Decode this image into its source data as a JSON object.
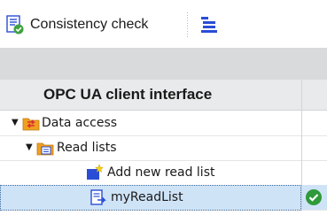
{
  "toolbar": {
    "consistency_label": "Consistency check",
    "consistency_icon": "consistency-check-icon",
    "list_icon": "list-view-icon"
  },
  "panel": {
    "title": "OPC UA client interface"
  },
  "tree": {
    "items": [
      {
        "label": "Data access",
        "icon": "data-access-folder-icon",
        "expanded": true
      },
      {
        "label": "Read lists",
        "icon": "read-lists-folder-icon",
        "expanded": true
      },
      {
        "label": "Add new read list",
        "icon": "add-new-icon"
      },
      {
        "label": "myReadList",
        "icon": "read-list-icon",
        "selected": true,
        "status": "ok"
      }
    ]
  },
  "colors": {
    "accent_blue": "#2a4dd6",
    "selection": "#cfe3f7",
    "status_ok": "#2e9a3a",
    "folder_orange": "#f0a020"
  }
}
